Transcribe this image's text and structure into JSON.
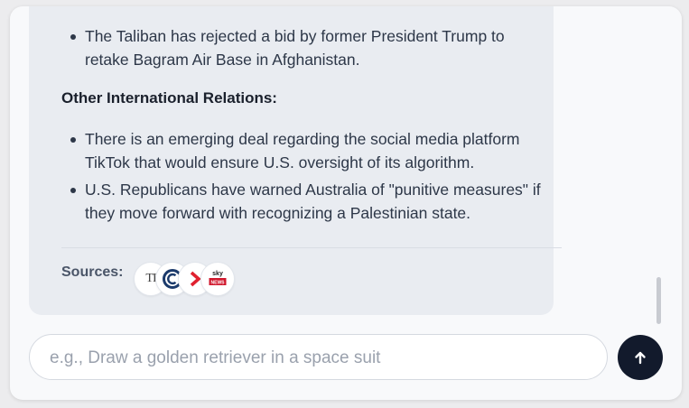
{
  "chat": {
    "partial_line": "• ... r",
    "list1": [
      "The Taliban has rejected a bid by former President Trump to retake Bagram Air Base in Afghanistan."
    ],
    "heading": "Other International Relations:",
    "list2": [
      "There is an emerging deal regarding the social media platform TikTok that would ensure U.S. oversight of its algorithm.",
      "U.S. Republicans have warned Australia of \"punitive measures\" if they move forward with recognizing a Palestinian state."
    ],
    "sources_label": "Sources:",
    "sources": [
      {
        "icon": "times-of-india-icon",
        "text": "TI"
      },
      {
        "icon": "the-economist-c-icon"
      },
      {
        "icon": "red-arrow-icon"
      },
      {
        "icon": "sky-news-icon",
        "text": "sky",
        "subtext": "NEWS"
      }
    ]
  },
  "composer": {
    "placeholder": "e.g., Draw a golden retriever in a space suit",
    "value": ""
  },
  "colors": {
    "bubble": "#e9ecf1",
    "send_button": "#121a2c",
    "sky_red": "#d0172c"
  }
}
